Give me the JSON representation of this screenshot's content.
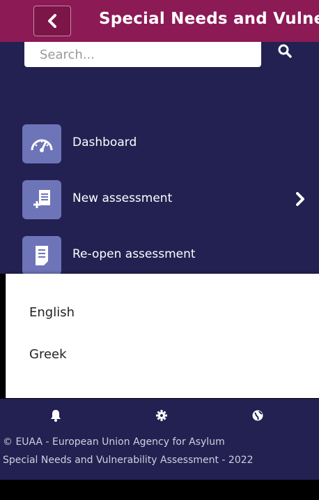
{
  "header": {
    "title": "Special Needs and Vulnerability Assessment"
  },
  "search": {
    "placeholder": "Search..."
  },
  "nav": {
    "items": [
      {
        "label": "Dashboard",
        "icon": "speedometer-icon"
      },
      {
        "label": "New assessment",
        "icon": "new-document-icon"
      },
      {
        "label": "Re-open assessment",
        "icon": "document-icon"
      }
    ]
  },
  "languages": {
    "options": [
      "English",
      "Greek"
    ]
  },
  "bottom_bar": {
    "icons": [
      "bell-icon",
      "gear-icon",
      "globe-icon"
    ]
  },
  "footer": {
    "line1": "© EUAA - European Union Agency for Asylum",
    "line2": "Special Needs and Vulnerability Assessment - 2022"
  },
  "colors": {
    "header_bg": "#8b1a55",
    "panel_bg": "#232152",
    "icon_box_bg": "#6e74b8"
  }
}
